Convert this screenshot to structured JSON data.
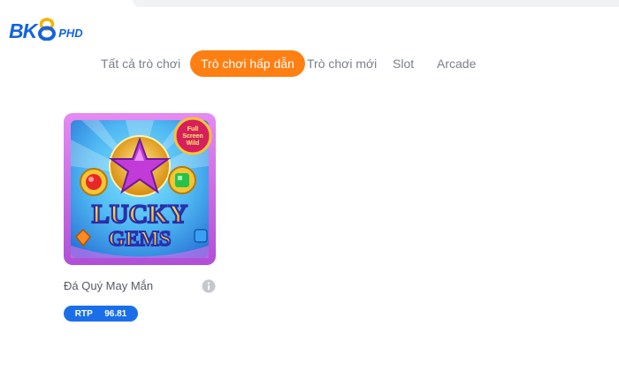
{
  "brand": {
    "logo_main": "BK",
    "logo_sub": "PHD",
    "accent_color": "#1463e0"
  },
  "tabs": [
    {
      "label": "Tất cả trò chơi",
      "active": false
    },
    {
      "label": "Trò chơi hấp dẫn",
      "active": true
    },
    {
      "label": "Trò chơi mới",
      "active": false
    },
    {
      "label": "Slot",
      "active": false
    },
    {
      "label": "Arcade",
      "active": false
    }
  ],
  "active_tab_color": "#ff7f12",
  "games": [
    {
      "title": "Đá Quý May Mắn",
      "thumbnail_text_line1": "LUCKY",
      "thumbnail_text_line2": "GEMS",
      "badge_line1": "Full",
      "badge_line2": "Screen",
      "badge_line3": "Wild",
      "rtp_label": "RTP",
      "rtp_value": "96.81",
      "info_icon": "info-icon"
    }
  ]
}
